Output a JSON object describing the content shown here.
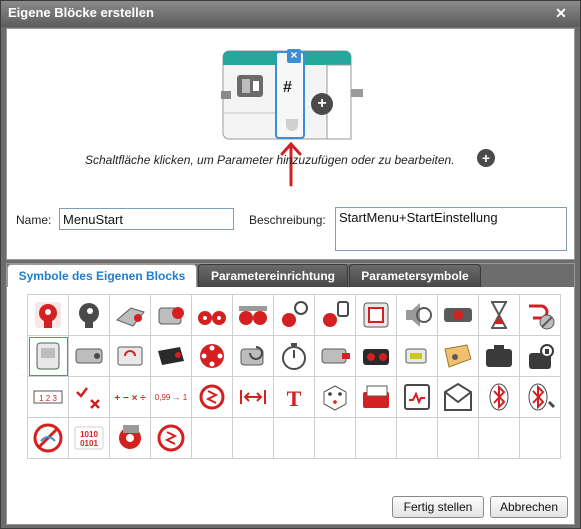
{
  "window": {
    "title": "Eigene Blöcke erstellen",
    "close_glyph": "✕"
  },
  "block": {
    "param_glyph": "#",
    "remove_glyph": "×",
    "add_glyph": "+"
  },
  "hint": {
    "text": "Schaltfläche klicken, um Parameter hinzuzufügen oder zu bearbeiten.",
    "plus_glyph": "+"
  },
  "name": {
    "label": "Name:",
    "value": "MenuStart"
  },
  "description": {
    "label": "Beschreibung:",
    "value": "StartMenu+StartEinstellung"
  },
  "tabs": [
    {
      "label": "Symbole des Eigenen Blocks",
      "active": true
    },
    {
      "label": "Parametereinrichtung",
      "active": false
    },
    {
      "label": "Parametersymbole",
      "active": false
    }
  ],
  "icons": [
    "brain-red-icon",
    "brain-gray-icon",
    "large-motor-icon",
    "medium-motor-icon",
    "move-steering-icon",
    "move-tank-icon",
    "steering-wheel-icon",
    "tank-treads-icon",
    "display-icon",
    "sound-icon",
    "brick-buttons-icon",
    "timer-hourglass-icon",
    "stop-program-icon",
    "brick-status-icon",
    "color-sensor-icon",
    "gyro-sensor-icon",
    "ir-sensor-icon",
    "brick-buttons-cross-icon",
    "motor-rotation-icon",
    "stopwatch-icon",
    "temperature-sensor-icon",
    "ultrasonic-sensor-icon",
    "energy-meter-icon",
    "nxt-sound-sensor-icon",
    "file-access-icon",
    "data-logging-icon",
    "array-icon",
    "logic-icon",
    "math-icon",
    "round-icon",
    "compare-icon",
    "range-icon",
    "text-icon",
    "random-icon",
    "variable-file-icon",
    "invert-motor-icon",
    "messaging-icon",
    "bluetooth-icon",
    "bluetooth-connection-icon",
    "keep-awake-icon",
    "raw-sensor-icon",
    "unregulated-motor-icon",
    "comment-icon"
  ],
  "icon_text": {
    "math": "+ − × ÷",
    "round": "0,99 → 1",
    "text": "T",
    "raw": "1010 0101",
    "array": "1 2 3"
  },
  "buttons": {
    "finish": "Fertig stellen",
    "cancel": "Abbrechen"
  },
  "colors": {
    "accent_red": "#d42020",
    "tab_active_text": "#1c7fd0",
    "teal_header": "#24a89c",
    "selection": "#3c8fd6"
  }
}
